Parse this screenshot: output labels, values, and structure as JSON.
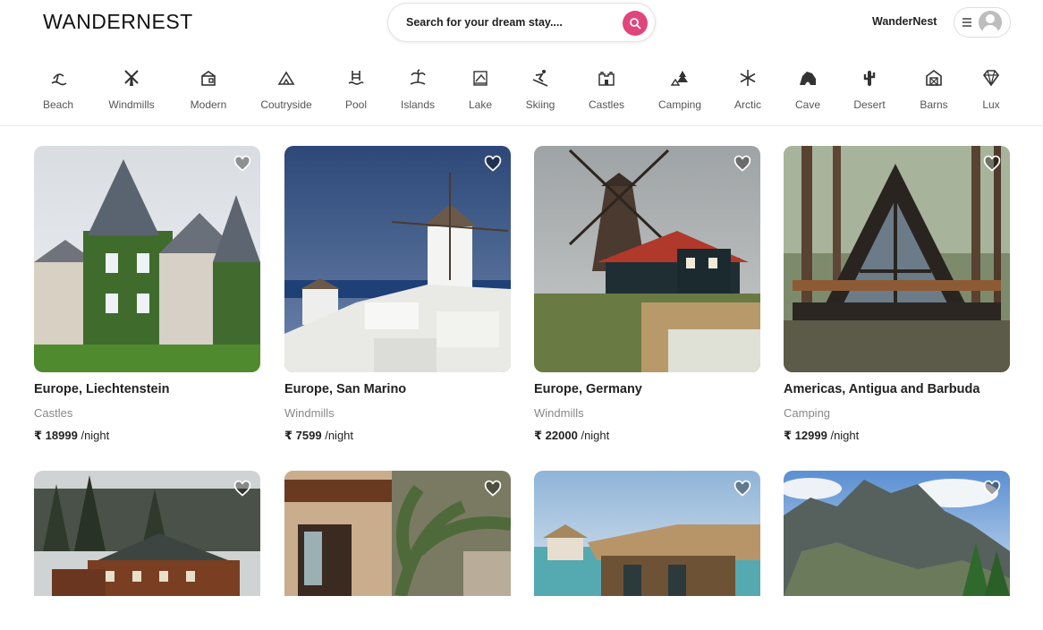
{
  "header": {
    "logo": "WANDERNEST",
    "search_placeholder": "Search for your dream stay....",
    "brand_link": "WanderNest"
  },
  "categories": [
    {
      "label": "Beach",
      "icon": "beach-icon"
    },
    {
      "label": "Windmills",
      "icon": "windmill-icon"
    },
    {
      "label": "Modern",
      "icon": "modern-house-icon"
    },
    {
      "label": "Coutryside",
      "icon": "mountain-icon"
    },
    {
      "label": "Pool",
      "icon": "pool-icon"
    },
    {
      "label": "Islands",
      "icon": "island-icon"
    },
    {
      "label": "Lake",
      "icon": "lake-icon"
    },
    {
      "label": "Skiing",
      "icon": "skiing-icon"
    },
    {
      "label": "Castles",
      "icon": "castle-icon"
    },
    {
      "label": "Camping",
      "icon": "camping-icon"
    },
    {
      "label": "Arctic",
      "icon": "snowflake-icon"
    },
    {
      "label": "Cave",
      "icon": "cave-icon"
    },
    {
      "label": "Desert",
      "icon": "cactus-icon"
    },
    {
      "label": "Barns",
      "icon": "barn-icon"
    },
    {
      "label": "Lux",
      "icon": "diamond-icon"
    }
  ],
  "listings": [
    {
      "location": "Europe, Liechtenstein",
      "category": "Castles",
      "currency": "₹",
      "price": "18999",
      "unit": "/night",
      "image": "castle-photo"
    },
    {
      "location": "Europe, San Marino",
      "category": "Windmills",
      "currency": "₹",
      "price": "7599",
      "unit": "/night",
      "image": "windmill-village-photo"
    },
    {
      "location": "Europe, Germany",
      "category": "Windmills",
      "currency": "₹",
      "price": "22000",
      "unit": "/night",
      "image": "windmill-farm-photo"
    },
    {
      "location": "Americas, Antigua and Barbuda",
      "category": "Camping",
      "currency": "₹",
      "price": "12999",
      "unit": "/night",
      "image": "a-frame-cabin-photo"
    }
  ],
  "listings_row2": [
    {
      "image": "forest-lodge-photo"
    },
    {
      "image": "tropical-apartment-photo"
    },
    {
      "image": "water-villa-photo"
    },
    {
      "image": "mountain-photo"
    }
  ],
  "colors": {
    "accent": "#e0457b",
    "muted_text": "#888888"
  }
}
